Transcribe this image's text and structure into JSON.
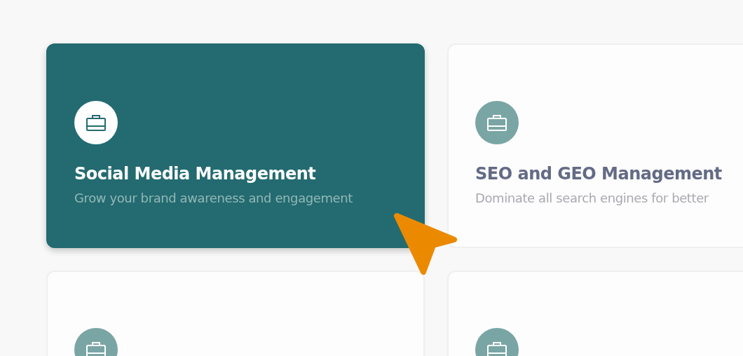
{
  "cards": [
    {
      "title": "Social Media Management",
      "description": "Grow your brand awareness and engagement",
      "selected": true
    },
    {
      "title": "SEO and GEO Management",
      "description": "Dominate all search engines for better",
      "selected": false
    },
    {
      "selected": false
    },
    {
      "selected": false
    }
  ]
}
